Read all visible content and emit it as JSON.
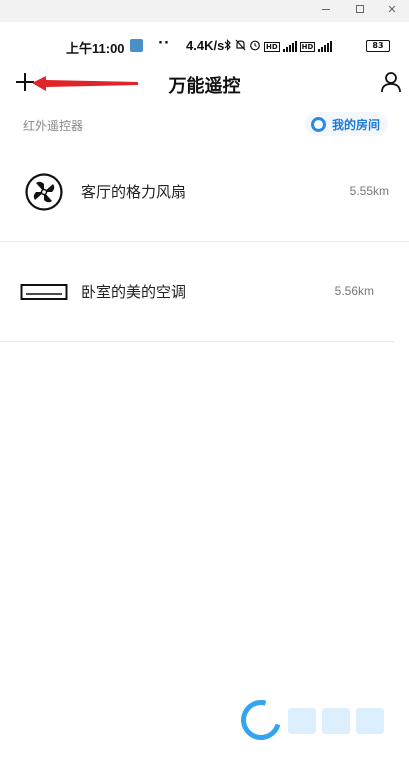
{
  "window": {
    "minimize_icon": "minimize-icon",
    "maximize_icon": "maximize-icon",
    "close_icon": "close-icon"
  },
  "status_bar": {
    "time": "上午11:00",
    "dots": "··",
    "network_speed": "4.4K/s",
    "icons": [
      "bluetooth-icon",
      "mute-icon",
      "alarm-icon",
      "hd-icon",
      "signal-5g-icon",
      "hd-icon",
      "signal-4g-icon"
    ],
    "battery": "83"
  },
  "header": {
    "title": "万能遥控",
    "add_icon": "plus-icon",
    "user_icon": "user-icon",
    "annotation_color": "#e0242a"
  },
  "subheader": {
    "section_label": "红外遥控器",
    "my_room_label": "我的房间"
  },
  "devices": [
    {
      "name": "客厅的格力风扇",
      "distance": "5.55km",
      "icon": "fan-icon"
    },
    {
      "name": "卧室的美的空调",
      "distance": "5.56km",
      "icon": "air-conditioner-icon"
    }
  ],
  "colors": {
    "accent": "#1e78d6",
    "watermark": "#1d9bf0"
  }
}
